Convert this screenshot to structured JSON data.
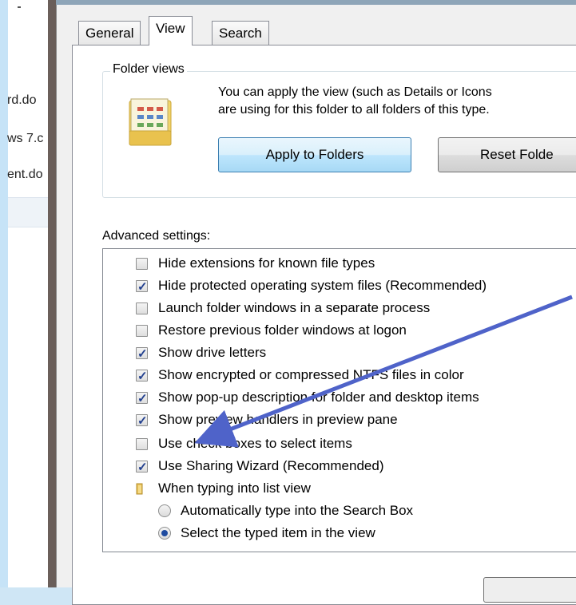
{
  "background_window": {
    "files": [
      "rd.do",
      "ws 7.c",
      "ent.do"
    ]
  },
  "tabs": [
    {
      "label": "General",
      "active": false
    },
    {
      "label": "View",
      "active": true
    },
    {
      "label": "Search",
      "active": false
    }
  ],
  "folder_views": {
    "title": "Folder views",
    "description_line1": "You can apply the view (such as Details or Icons",
    "description_line2": "are using for this folder to all folders of this type.",
    "apply_button": "Apply to Folders",
    "reset_button": "Reset Folde"
  },
  "advanced": {
    "label": "Advanced settings:",
    "items": [
      {
        "type": "checkbox",
        "label": "Hide extensions for known file types",
        "checked": false
      },
      {
        "type": "checkbox",
        "label": "Hide protected operating system files (Recommended)",
        "checked": true
      },
      {
        "type": "checkbox",
        "label": "Launch folder windows in a separate process",
        "checked": false
      },
      {
        "type": "checkbox",
        "label": "Restore previous folder windows at logon",
        "checked": false
      },
      {
        "type": "checkbox",
        "label": "Show drive letters",
        "checked": true
      },
      {
        "type": "checkbox",
        "label": "Show encrypted or compressed NTFS files in color",
        "checked": true
      },
      {
        "type": "checkbox",
        "label": "Show pop-up description for folder and desktop items",
        "checked": true
      },
      {
        "type": "checkbox",
        "label": "Show preview handlers in preview pane",
        "checked": true
      },
      {
        "type": "checkbox",
        "label": "Use check boxes to select items",
        "checked": false
      },
      {
        "type": "checkbox",
        "label": "Use Sharing Wizard (Recommended)",
        "checked": true
      },
      {
        "type": "folder",
        "label": "When typing into list view"
      },
      {
        "type": "radio",
        "label": "Automatically type into the Search Box",
        "selected": false
      },
      {
        "type": "radio",
        "label": "Select the typed item in the view",
        "selected": true
      }
    ]
  },
  "colors": {
    "arrow": "#4f63c9",
    "check": "#213f8e"
  },
  "icons": {
    "folder_views": "folder-views-icon",
    "tree_folder": "folder-icon",
    "annotation": "arrow-annotation-icon"
  }
}
